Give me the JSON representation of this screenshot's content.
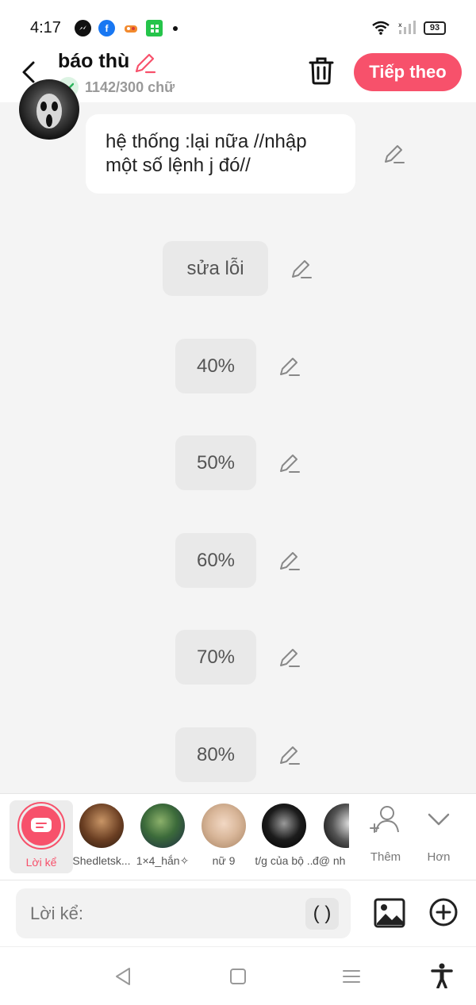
{
  "status_bar": {
    "time": "4:17",
    "battery": "93"
  },
  "header": {
    "title": "báo thù",
    "word_count": "1142/300 chữ",
    "next_label": "Tiếp theo"
  },
  "message": {
    "text_line1": "hệ thống :lại nữa //nhập",
    "text_line2": "một số lệnh j đó//"
  },
  "pills": [
    "sửa lỗi",
    "40%",
    "50%",
    "60%",
    "70%",
    "80%"
  ],
  "characters": {
    "narrator_label": "Lời kể",
    "items": [
      "Shedletsk...",
      "1×4_hắn✧",
      "nữ 9",
      "t/g của bộ ..",
      "đ@ nh"
    ],
    "more_label": "Thêm",
    "less_label": "Hơn"
  },
  "input": {
    "placeholder": "Lời kể:",
    "paren_label": "( )"
  },
  "colors": {
    "accent": "#f7516b",
    "background": "#f4f4f4"
  }
}
